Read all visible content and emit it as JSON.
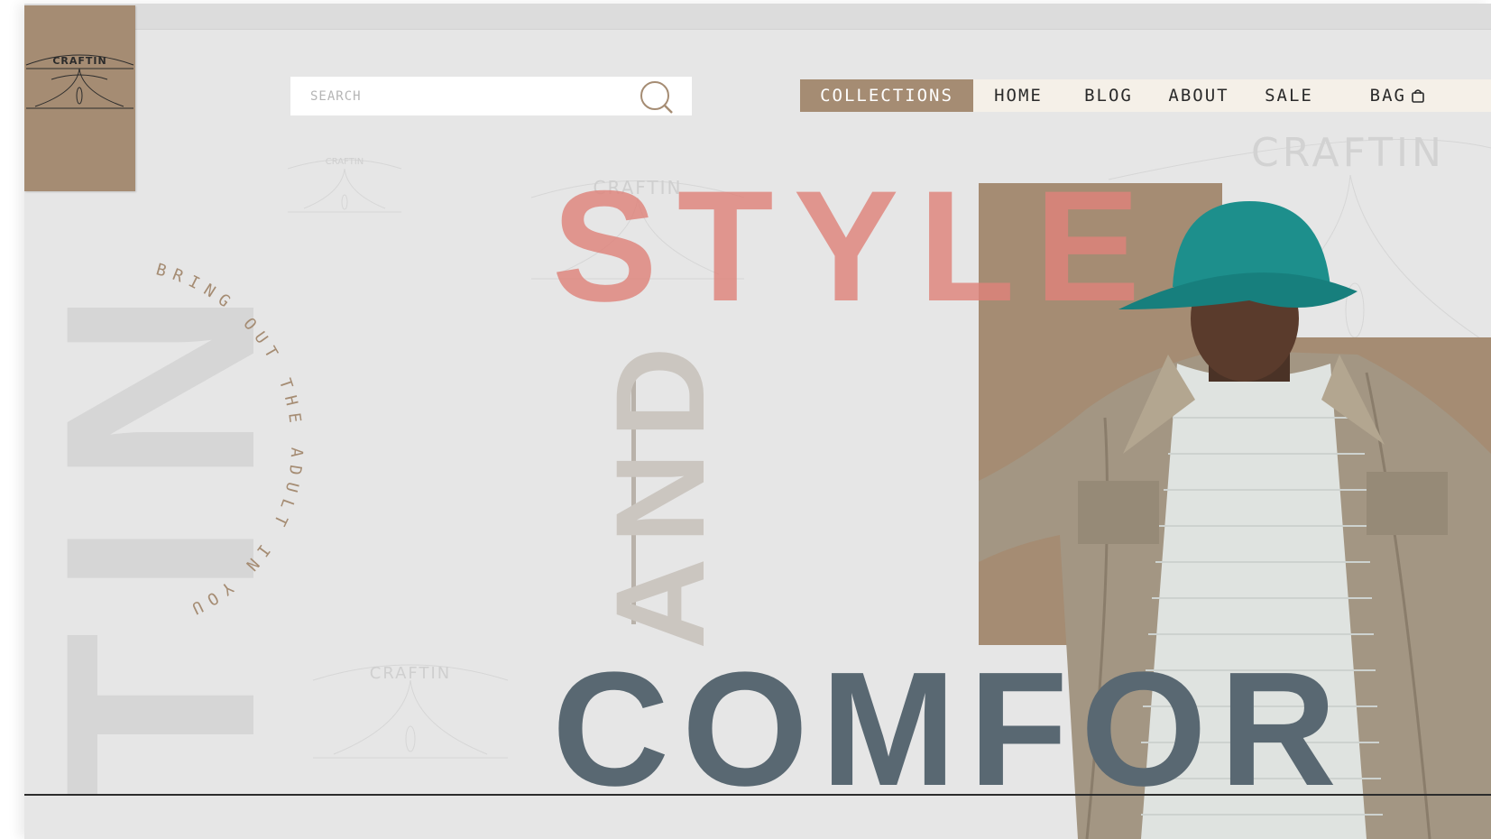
{
  "brand": {
    "logo_text": "CRAFTIN"
  },
  "search": {
    "placeholder": "SEARCH",
    "value": ""
  },
  "nav": {
    "items": [
      {
        "label": "COLLECTIONS",
        "active": true
      },
      {
        "label": "HOME",
        "active": false
      },
      {
        "label": "BLOG",
        "active": false
      },
      {
        "label": "ABOUT",
        "active": false
      },
      {
        "label": "SALE",
        "active": false
      },
      {
        "label": "BAG",
        "active": false,
        "icon": "shopping-bag-icon"
      }
    ]
  },
  "hero": {
    "headline_top": "STYLE",
    "connector": "AND",
    "headline_bottom": "COMFOR",
    "tagline": "BRING OUT THE ADULT IN YOU",
    "side_letters": "TIN",
    "watermark_text": "CRAFTIN"
  },
  "colors": {
    "accent_brown": "#a58c73",
    "style_pink": "#de827a",
    "comfort_slate": "#596872",
    "background": "#e6e6e6",
    "nav_bg": "#f5f0e8"
  }
}
